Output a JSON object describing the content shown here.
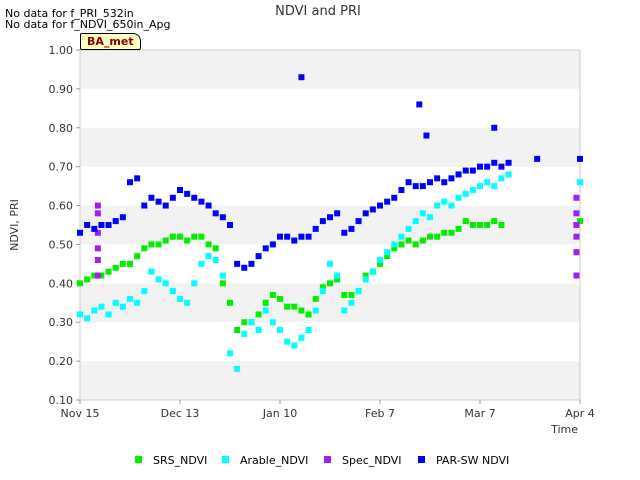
{
  "chart_data": {
    "type": "scatter",
    "title": "NDVI and PRI",
    "xlabel": "Time",
    "ylabel": "NDVI, PRI",
    "ylim": [
      0.1,
      1.0
    ],
    "xlim": [
      "Nov 15",
      "Apr 4"
    ],
    "x_tick_labels": [
      "Nov 15",
      "Dec 13",
      "Jan 10",
      "Feb 7",
      "Mar 7",
      "Apr 4"
    ],
    "y_tick_labels": [
      "0.10",
      "0.20",
      "0.30",
      "0.40",
      "0.50",
      "0.60",
      "0.70",
      "0.80",
      "0.90",
      "1.00"
    ],
    "grid": "alternating horizontal bands",
    "legend_position": "bottom",
    "series": [
      {
        "name": "SRS_NDVI",
        "color": "#00ee00",
        "points": [
          [
            0,
            0.4
          ],
          [
            2,
            0.41
          ],
          [
            4,
            0.42
          ],
          [
            6,
            0.42
          ],
          [
            8,
            0.43
          ],
          [
            10,
            0.44
          ],
          [
            12,
            0.45
          ],
          [
            14,
            0.45
          ],
          [
            16,
            0.47
          ],
          [
            18,
            0.49
          ],
          [
            20,
            0.5
          ],
          [
            22,
            0.5
          ],
          [
            24,
            0.51
          ],
          [
            26,
            0.52
          ],
          [
            28,
            0.52
          ],
          [
            30,
            0.51
          ],
          [
            32,
            0.52
          ],
          [
            34,
            0.52
          ],
          [
            36,
            0.5
          ],
          [
            38,
            0.49
          ],
          [
            40,
            0.4
          ],
          [
            42,
            0.35
          ],
          [
            44,
            0.28
          ],
          [
            46,
            0.3
          ],
          [
            48,
            0.3
          ],
          [
            50,
            0.32
          ],
          [
            52,
            0.35
          ],
          [
            54,
            0.37
          ],
          [
            56,
            0.36
          ],
          [
            58,
            0.34
          ],
          [
            60,
            0.34
          ],
          [
            62,
            0.33
          ],
          [
            64,
            0.32
          ],
          [
            66,
            0.36
          ],
          [
            68,
            0.39
          ],
          [
            70,
            0.4
          ],
          [
            72,
            0.41
          ],
          [
            74,
            0.37
          ],
          [
            76,
            0.37
          ],
          [
            78,
            0.38
          ],
          [
            80,
            0.42
          ],
          [
            82,
            0.43
          ],
          [
            84,
            0.45
          ],
          [
            86,
            0.47
          ],
          [
            88,
            0.49
          ],
          [
            90,
            0.5
          ],
          [
            92,
            0.51
          ],
          [
            94,
            0.5
          ],
          [
            96,
            0.51
          ],
          [
            98,
            0.52
          ],
          [
            100,
            0.52
          ],
          [
            102,
            0.53
          ],
          [
            104,
            0.53
          ],
          [
            106,
            0.54
          ],
          [
            108,
            0.56
          ],
          [
            110,
            0.55
          ],
          [
            112,
            0.55
          ],
          [
            114,
            0.55
          ],
          [
            116,
            0.56
          ],
          [
            118,
            0.55
          ],
          [
            140,
            0.56
          ]
        ]
      },
      {
        "name": "Arable_NDVI",
        "color": "#00ffff",
        "points": [
          [
            0,
            0.32
          ],
          [
            2,
            0.31
          ],
          [
            4,
            0.33
          ],
          [
            6,
            0.34
          ],
          [
            8,
            0.32
          ],
          [
            10,
            0.35
          ],
          [
            12,
            0.34
          ],
          [
            14,
            0.36
          ],
          [
            16,
            0.35
          ],
          [
            18,
            0.38
          ],
          [
            20,
            0.43
          ],
          [
            22,
            0.41
          ],
          [
            24,
            0.4
          ],
          [
            26,
            0.38
          ],
          [
            28,
            0.36
          ],
          [
            30,
            0.35
          ],
          [
            32,
            0.4
          ],
          [
            34,
            0.45
          ],
          [
            36,
            0.47
          ],
          [
            38,
            0.46
          ],
          [
            40,
            0.42
          ],
          [
            42,
            0.22
          ],
          [
            44,
            0.18
          ],
          [
            46,
            0.27
          ],
          [
            48,
            0.3
          ],
          [
            50,
            0.28
          ],
          [
            52,
            0.33
          ],
          [
            54,
            0.3
          ],
          [
            56,
            0.28
          ],
          [
            58,
            0.25
          ],
          [
            60,
            0.24
          ],
          [
            62,
            0.26
          ],
          [
            64,
            0.28
          ],
          [
            66,
            0.33
          ],
          [
            68,
            0.38
          ],
          [
            70,
            0.45
          ],
          [
            72,
            0.42
          ],
          [
            74,
            0.33
          ],
          [
            76,
            0.35
          ],
          [
            78,
            0.38
          ],
          [
            80,
            0.41
          ],
          [
            82,
            0.43
          ],
          [
            84,
            0.46
          ],
          [
            86,
            0.48
          ],
          [
            88,
            0.5
          ],
          [
            90,
            0.52
          ],
          [
            92,
            0.54
          ],
          [
            94,
            0.56
          ],
          [
            96,
            0.58
          ],
          [
            98,
            0.57
          ],
          [
            100,
            0.6
          ],
          [
            102,
            0.61
          ],
          [
            104,
            0.6
          ],
          [
            106,
            0.62
          ],
          [
            108,
            0.63
          ],
          [
            110,
            0.64
          ],
          [
            112,
            0.65
          ],
          [
            114,
            0.66
          ],
          [
            116,
            0.65
          ],
          [
            118,
            0.67
          ],
          [
            120,
            0.68
          ],
          [
            140,
            0.66
          ]
        ]
      },
      {
        "name": "Spec_NDVI",
        "color": "#a020f0",
        "points": [
          [
            5,
            0.6
          ],
          [
            5,
            0.58
          ],
          [
            5,
            0.53
          ],
          [
            5,
            0.49
          ],
          [
            5,
            0.46
          ],
          [
            5,
            0.42
          ],
          [
            139,
            0.62
          ],
          [
            139,
            0.58
          ],
          [
            139,
            0.55
          ],
          [
            139,
            0.52
          ],
          [
            139,
            0.48
          ],
          [
            139,
            0.42
          ]
        ]
      },
      {
        "name": "PAR-SW NDVI",
        "color": "#0000ff",
        "points": [
          [
            0,
            0.53
          ],
          [
            2,
            0.55
          ],
          [
            4,
            0.54
          ],
          [
            6,
            0.55
          ],
          [
            8,
            0.55
          ],
          [
            10,
            0.56
          ],
          [
            12,
            0.57
          ],
          [
            14,
            0.66
          ],
          [
            16,
            0.67
          ],
          [
            18,
            0.6
          ],
          [
            20,
            0.62
          ],
          [
            22,
            0.61
          ],
          [
            24,
            0.6
          ],
          [
            26,
            0.62
          ],
          [
            28,
            0.64
          ],
          [
            30,
            0.63
          ],
          [
            32,
            0.62
          ],
          [
            34,
            0.61
          ],
          [
            36,
            0.6
          ],
          [
            38,
            0.58
          ],
          [
            40,
            0.57
          ],
          [
            42,
            0.55
          ],
          [
            44,
            0.45
          ],
          [
            46,
            0.44
          ],
          [
            48,
            0.45
          ],
          [
            50,
            0.47
          ],
          [
            52,
            0.49
          ],
          [
            54,
            0.5
          ],
          [
            56,
            0.52
          ],
          [
            58,
            0.52
          ],
          [
            60,
            0.51
          ],
          [
            62,
            0.52
          ],
          [
            64,
            0.52
          ],
          [
            66,
            0.54
          ],
          [
            68,
            0.56
          ],
          [
            70,
            0.57
          ],
          [
            72,
            0.58
          ],
          [
            74,
            0.53
          ],
          [
            76,
            0.54
          ],
          [
            78,
            0.56
          ],
          [
            80,
            0.58
          ],
          [
            82,
            0.59
          ],
          [
            84,
            0.6
          ],
          [
            86,
            0.61
          ],
          [
            88,
            0.62
          ],
          [
            90,
            0.64
          ],
          [
            92,
            0.66
          ],
          [
            94,
            0.65
          ],
          [
            96,
            0.65
          ],
          [
            98,
            0.66
          ],
          [
            100,
            0.67
          ],
          [
            102,
            0.66
          ],
          [
            104,
            0.67
          ],
          [
            106,
            0.68
          ],
          [
            108,
            0.69
          ],
          [
            110,
            0.69
          ],
          [
            112,
            0.7
          ],
          [
            114,
            0.7
          ],
          [
            116,
            0.71
          ],
          [
            118,
            0.7
          ],
          [
            120,
            0.71
          ],
          [
            128,
            0.72
          ],
          [
            140,
            0.72
          ],
          [
            62,
            0.93
          ],
          [
            95,
            0.86
          ],
          [
            97,
            0.78
          ],
          [
            116,
            0.8
          ]
        ]
      }
    ],
    "annotations": [
      "No data for f_PRI_532in",
      "No data for f_NDVI_650in_Apg",
      "BA_met"
    ]
  }
}
